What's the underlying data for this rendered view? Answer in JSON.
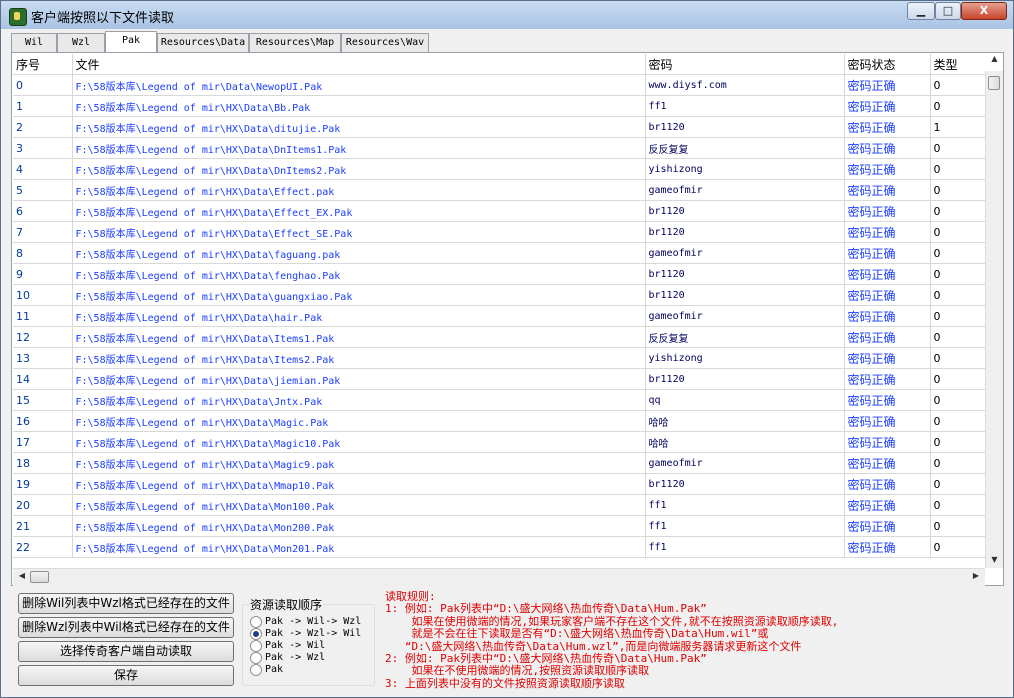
{
  "window": {
    "title": "客户端按照以下文件读取",
    "buttons": {
      "minimize": "▁",
      "maximize": "□",
      "close": "X"
    }
  },
  "tabs": [
    "Wil",
    "Wzl",
    "Pak",
    "Resources\\Data",
    "Resources\\Map",
    "Resources\\Wav"
  ],
  "active_tab": "Pak",
  "table": {
    "columns": [
      "序号",
      "文件",
      "密码",
      "密码状态",
      "类型"
    ],
    "rows": [
      [
        "0",
        "F:\\58版本库\\Legend of mir\\Data\\NewopUI.Pak",
        "www.diysf.com",
        "密码正确",
        "0"
      ],
      [
        "1",
        "F:\\58版本库\\Legend of mir\\HX\\Data\\Bb.Pak",
        "ff1",
        "密码正确",
        "0"
      ],
      [
        "2",
        "F:\\58版本库\\Legend of mir\\HX\\Data\\ditujie.Pak",
        "br1120",
        "密码正确",
        "1"
      ],
      [
        "3",
        "F:\\58版本库\\Legend of mir\\HX\\Data\\DnItems1.Pak",
        "反反复复",
        "密码正确",
        "0"
      ],
      [
        "4",
        "F:\\58版本库\\Legend of mir\\HX\\Data\\DnItems2.Pak",
        "yishizong",
        "密码正确",
        "0"
      ],
      [
        "5",
        "F:\\58版本库\\Legend of mir\\HX\\Data\\Effect.pak",
        "gameofmir",
        "密码正确",
        "0"
      ],
      [
        "6",
        "F:\\58版本库\\Legend of mir\\HX\\Data\\Effect_EX.Pak",
        "br1120",
        "密码正确",
        "0"
      ],
      [
        "7",
        "F:\\58版本库\\Legend of mir\\HX\\Data\\Effect_SE.Pak",
        "br1120",
        "密码正确",
        "0"
      ],
      [
        "8",
        "F:\\58版本库\\Legend of mir\\HX\\Data\\faguang.pak",
        "gameofmir",
        "密码正确",
        "0"
      ],
      [
        "9",
        "F:\\58版本库\\Legend of mir\\HX\\Data\\fenghao.Pak",
        "br1120",
        "密码正确",
        "0"
      ],
      [
        "10",
        "F:\\58版本库\\Legend of mir\\HX\\Data\\guangxiao.Pak",
        "br1120",
        "密码正确",
        "0"
      ],
      [
        "11",
        "F:\\58版本库\\Legend of mir\\HX\\Data\\hair.Pak",
        "gameofmir",
        "密码正确",
        "0"
      ],
      [
        "12",
        "F:\\58版本库\\Legend of mir\\HX\\Data\\Items1.Pak",
        "反反复复",
        "密码正确",
        "0"
      ],
      [
        "13",
        "F:\\58版本库\\Legend of mir\\HX\\Data\\Items2.Pak",
        "yishizong",
        "密码正确",
        "0"
      ],
      [
        "14",
        "F:\\58版本库\\Legend of mir\\HX\\Data\\jiemian.Pak",
        "br1120",
        "密码正确",
        "0"
      ],
      [
        "15",
        "F:\\58版本库\\Legend of mir\\HX\\Data\\Jntx.Pak",
        "qq",
        "密码正确",
        "0"
      ],
      [
        "16",
        "F:\\58版本库\\Legend of mir\\HX\\Data\\Magic.Pak",
        "哈哈",
        "密码正确",
        "0"
      ],
      [
        "17",
        "F:\\58版本库\\Legend of mir\\HX\\Data\\Magic10.Pak",
        "哈哈",
        "密码正确",
        "0"
      ],
      [
        "18",
        "F:\\58版本库\\Legend of mir\\HX\\Data\\Magic9.pak",
        "gameofmir",
        "密码正确",
        "0"
      ],
      [
        "19",
        "F:\\58版本库\\Legend of mir\\HX\\Data\\Mmap10.Pak",
        "br1120",
        "密码正确",
        "0"
      ],
      [
        "20",
        "F:\\58版本库\\Legend of mir\\HX\\Data\\Mon100.Pak",
        "ff1",
        "密码正确",
        "0"
      ],
      [
        "21",
        "F:\\58版本库\\Legend of mir\\HX\\Data\\Mon200.Pak",
        "ff1",
        "密码正确",
        "0"
      ],
      [
        "22",
        "F:\\58版本库\\Legend of mir\\HX\\Data\\Mon201.Pak",
        "ff1",
        "密码正确",
        "0"
      ]
    ]
  },
  "buttons": {
    "delete_wil": "删除Wil列表中Wzl格式已经存在的文件",
    "delete_wzl": "删除Wzl列表中Wil格式已经存在的文件",
    "auto_read": "选择传奇客户端自动读取",
    "save": "保存"
  },
  "read_order": {
    "title": "资源读取顺序",
    "options": [
      "Pak -> Wil-> Wzl",
      "Pak -> Wzl-> Wil",
      "Pak -> Wil",
      "Pak -> Wzl",
      "Pak"
    ],
    "selected_index": 1
  },
  "rules": {
    "text": "读取规则:\n1: 例如: Pak列表中“D:\\盛大网络\\热血传奇\\Data\\Hum.Pak”\n    如果在使用微端的情况,如果玩家客户端不存在这个文件,就不在按照资源读取顺序读取,\n    就是不会在往下读取是否有“D:\\盛大网络\\热血传奇\\Data\\Hum.wil”或\n   “D:\\盛大网络\\热血传奇\\Data\\Hum.wzl”,而是向微端服务器请求更新这个文件\n2: 例如: Pak列表中“D:\\盛大网络\\热血传奇\\Data\\Hum.Pak”\n    如果在不使用微端的情况,按照资源读取顺序读取\n3: 上面列表中没有的文件按照资源读取顺序读取"
  }
}
